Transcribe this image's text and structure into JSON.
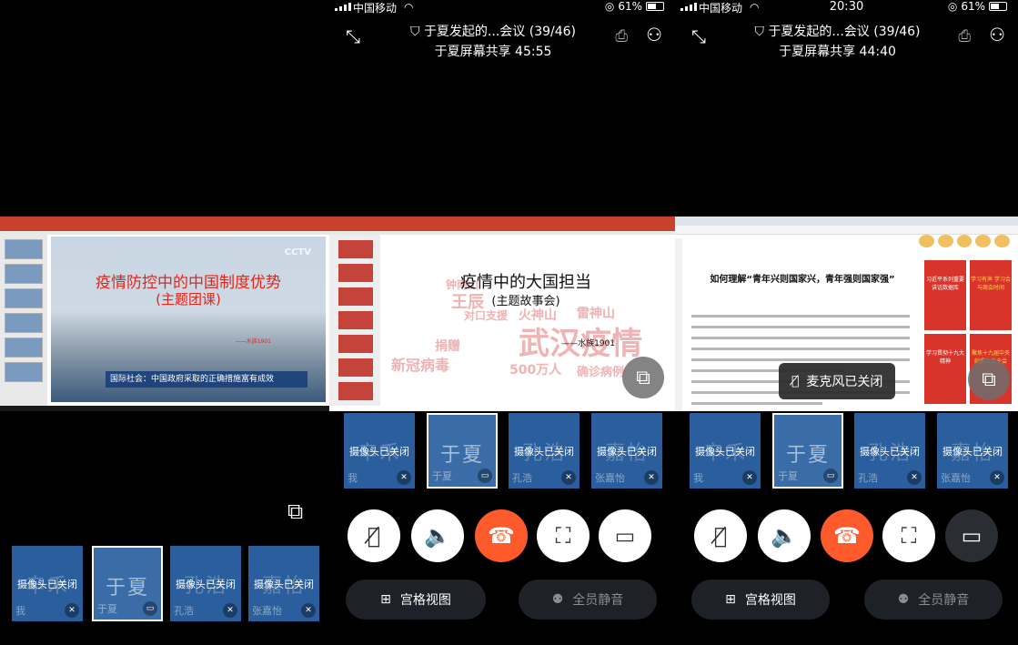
{
  "screen1": {
    "slide": {
      "title": "疫情防控中的中国制度优势",
      "subtitle": "(主题团课)",
      "signature": "——水族1901",
      "caption": "国际社会：中国政府采取的正确措施富有成效",
      "logo": "CCTV"
    },
    "tiles": [
      {
        "bg": "辛禾",
        "status": "摄像头已关闭",
        "name": "我",
        "icon": "mic-off-icon"
      },
      {
        "bg": "于夏",
        "status": "",
        "name": "于夏",
        "icon": "screen-share-icon",
        "active": true
      },
      {
        "bg": "孔浩",
        "status": "摄像头已关闭",
        "name": "孔浩",
        "icon": "mic-off-icon"
      },
      {
        "bg": "嘉怡",
        "status": "摄像头已关闭",
        "name": "张嘉怡",
        "icon": "mic-off-icon"
      }
    ]
  },
  "screen2": {
    "status": {
      "carrier": "中国移动",
      "time": "",
      "battery": "61%"
    },
    "meeting_title": "于夏发起的...会议 (39/46)",
    "sharing_text": "于夏屏幕共享  45:55",
    "slide": {
      "title": "疫情中的大国担当",
      "subtitle": "(主题故事会)",
      "signature": "——水族1901",
      "words": [
        "武汉疫情",
        "火神山",
        "雷神山",
        "新冠病毒",
        "500万人",
        "确诊病例",
        "捐赠",
        "对口支援",
        "钟南山",
        "王辰"
      ]
    },
    "tiles": [
      {
        "bg": "辛禾",
        "status": "摄像头已关闭",
        "name": "我",
        "icon": "mic-off-icon"
      },
      {
        "bg": "于夏",
        "status": "",
        "name": "于夏",
        "icon": "screen-share-icon",
        "active": true
      },
      {
        "bg": "孔浩",
        "status": "摄像头已关闭",
        "name": "孔浩",
        "icon": "mic-off-icon"
      },
      {
        "bg": "嘉怡",
        "status": "摄像头已关闭",
        "name": "张嘉怡",
        "icon": "mic-off-icon"
      }
    ],
    "grid_view": "宫格视图",
    "mute_all": "全员静音"
  },
  "screen3": {
    "status": {
      "carrier": "中国移动",
      "time": "20:30",
      "battery": "61%"
    },
    "meeting_title": "于夏发起的...会议 (39/46)",
    "sharing_text": "于夏屏幕共享  44:40",
    "web": {
      "headline": "如何理解“青年兴则国家兴，青年强则国家强”",
      "side": [
        "习近平系列重要讲话数据库",
        "学习有声 学习会与周会时间",
        "学习贯彻十九大精神",
        "聚焦十九届中央纪委三次全会"
      ]
    },
    "mic_toast": "麦克风已关闭",
    "tiles": [
      {
        "bg": "辛禾",
        "status": "摄像头已关闭",
        "name": "我",
        "icon": "mic-off-icon"
      },
      {
        "bg": "于夏",
        "status": "",
        "name": "于夏",
        "icon": "screen-share-icon",
        "active": true
      },
      {
        "bg": "孔浩",
        "status": "摄像头已关闭",
        "name": "孔浩",
        "icon": "mic-off-icon"
      },
      {
        "bg": "嘉怡",
        "status": "摄像头已关闭",
        "name": "张嘉怡",
        "icon": "mic-off-icon"
      }
    ],
    "grid_view": "宫格视图",
    "mute_all": "全员静音"
  },
  "colors": {
    "tile": "#2a5e9c",
    "hangup": "#ff5a2b",
    "slide_title_red": "#e0261b"
  }
}
